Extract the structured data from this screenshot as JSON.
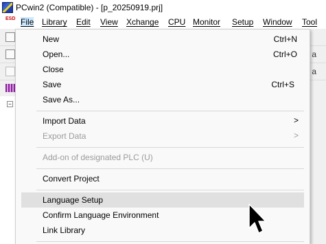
{
  "window": {
    "title": "PCwin2 (Compatible)  - [p_20250919.prj]"
  },
  "system_icon_text": "ESD",
  "menubar": [
    {
      "label": "File",
      "active": true
    },
    {
      "label": "Library"
    },
    {
      "label": "Edit"
    },
    {
      "label": "View"
    },
    {
      "label": "Xchange"
    },
    {
      "label": "CPU"
    },
    {
      "label": "Monitor"
    },
    {
      "label": "Setup"
    },
    {
      "label": "Window"
    },
    {
      "label": "Tool"
    }
  ],
  "toolbar_right": {
    "row2_text": "a",
    "row3_text": "a"
  },
  "file_menu": {
    "new": {
      "label": "New",
      "shortcut": "Ctrl+N"
    },
    "open": {
      "label": "Open...",
      "shortcut": "Ctrl+O"
    },
    "close": {
      "label": "Close"
    },
    "save": {
      "label": "Save",
      "shortcut": "Ctrl+S"
    },
    "save_as": {
      "label": "Save As..."
    },
    "import_data": {
      "label": "Import Data",
      "submenu": true
    },
    "export_data": {
      "label": "Export Data",
      "submenu": true,
      "disabled": true
    },
    "addon_plc": {
      "label": "Add-on of designated PLC (U)",
      "disabled": true
    },
    "convert_project": {
      "label": "Convert Project"
    },
    "language_setup": {
      "label": "Language Setup",
      "highlighted": true
    },
    "confirm_language": {
      "label": "Confirm Language Environment"
    },
    "link_library": {
      "label": "Link Library"
    }
  },
  "submenu_arrow": ">",
  "tree_expander": "−"
}
